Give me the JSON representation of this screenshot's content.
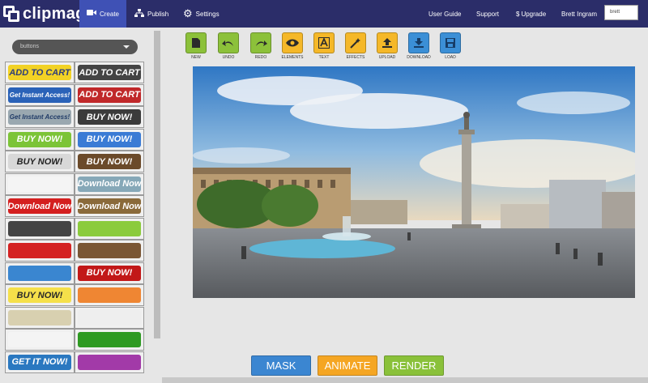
{
  "app": {
    "logo_text": "clipmagix"
  },
  "nav": {
    "create": "Create",
    "publish": "Publish",
    "settings": "Settings",
    "user_guide": "User Guide",
    "support": "Support",
    "upgrade": "Upgrade",
    "user_name": "Brett Ingram",
    "user_select": "brett"
  },
  "sidebar": {
    "dropdown_value": "buttons",
    "cells": [
      {
        "text": "ADD TO CART",
        "bg": "#f2d225",
        "fg": "#2f3e7a"
      },
      {
        "text": "ADD TO CART",
        "bg": "#444444",
        "fg": "#ffffff"
      },
      {
        "text": "Get Instant Access!",
        "bg": "#2a62b8",
        "fg": "#ffffff"
      },
      {
        "text": "ADD TO CART",
        "bg": "#c0282a",
        "fg": "#ffffff"
      },
      {
        "text": "Get Instant Access!",
        "bg": "#9aa8b0",
        "fg": "#1f3a66"
      },
      {
        "text": "BUY NOW!",
        "bg": "#3b3b3b",
        "fg": "#ffffff"
      },
      {
        "text": "BUY NOW!",
        "bg": "#7cc437",
        "fg": "#ffffff"
      },
      {
        "text": "BUY NOW!",
        "bg": "#3a7bd5",
        "fg": "#ffffff"
      },
      {
        "text": "BUY NOW!",
        "bg": "#d8d8d8",
        "fg": "#222222"
      },
      {
        "text": "BUY NOW!",
        "bg": "#6b4a2a",
        "fg": "#ffffff"
      },
      {
        "text": "",
        "bg": "#f4f4f4",
        "fg": "#333333"
      },
      {
        "text": "Download Now",
        "bg": "#86a8b8",
        "fg": "#ffffff"
      },
      {
        "text": "Download Now",
        "bg": "#d41f1f",
        "fg": "#ffffff"
      },
      {
        "text": "Download Now",
        "bg": "#8a6a3a",
        "fg": "#ffffff"
      },
      {
        "text": "",
        "bg": "#444444",
        "fg": "#ffffff"
      },
      {
        "text": "",
        "bg": "#8bcb3c",
        "fg": "#ffffff"
      },
      {
        "text": "",
        "bg": "#d42222",
        "fg": "#ffffff"
      },
      {
        "text": "",
        "bg": "#7a5634",
        "fg": "#ffffff"
      },
      {
        "text": "",
        "bg": "#3a86d0",
        "fg": "#ffffff"
      },
      {
        "text": "BUY NOW!",
        "bg": "#c21818",
        "fg": "#ffffff"
      },
      {
        "text": "BUY NOW!",
        "bg": "#f5e04a",
        "fg": "#2a2a2a"
      },
      {
        "text": "",
        "bg": "#ef8633",
        "fg": "#ffffff"
      },
      {
        "text": "",
        "bg": "#d8d0b0",
        "fg": "#333333"
      },
      {
        "text": "",
        "bg": "#eeeeee",
        "fg": "#333333"
      },
      {
        "text": "",
        "bg": "#f4f4f4",
        "fg": "#3a9a2a"
      },
      {
        "text": "",
        "bg": "#2e9a22",
        "fg": "#ffffff"
      },
      {
        "text": "GET IT NOW!",
        "bg": "#2a78c0",
        "fg": "#ffffff"
      },
      {
        "text": "",
        "bg": "#a23aa8",
        "fg": "#ffffff"
      }
    ]
  },
  "toolbar": {
    "tools": [
      {
        "label": "NEW",
        "color": "#8cc13a",
        "icon": "new-file-icon"
      },
      {
        "label": "UNDO",
        "color": "#8cc13a",
        "icon": "undo-icon"
      },
      {
        "label": "REDO",
        "color": "#8cc13a",
        "icon": "redo-icon"
      },
      {
        "label": "ELEMENTS",
        "color": "#f5b829",
        "icon": "eye-icon"
      },
      {
        "label": "TEXT",
        "color": "#f5b829",
        "icon": "text-icon"
      },
      {
        "label": "EFFECTS",
        "color": "#f5b829",
        "icon": "magic-wand-icon"
      },
      {
        "label": "UPLOAD",
        "color": "#f5b829",
        "icon": "upload-icon"
      },
      {
        "label": "DOWNLOAD",
        "color": "#3b8fd6",
        "icon": "download-icon"
      },
      {
        "label": "LOAD",
        "color": "#3b8fd6",
        "icon": "load-icon"
      }
    ]
  },
  "actions": {
    "mask": "MASK",
    "animate": "ANIMATE",
    "render": "RENDER"
  },
  "colors": {
    "topbar": "#2b2d69",
    "mask": "#3b86d1",
    "animate": "#f5a623",
    "render": "#8ac13a"
  }
}
